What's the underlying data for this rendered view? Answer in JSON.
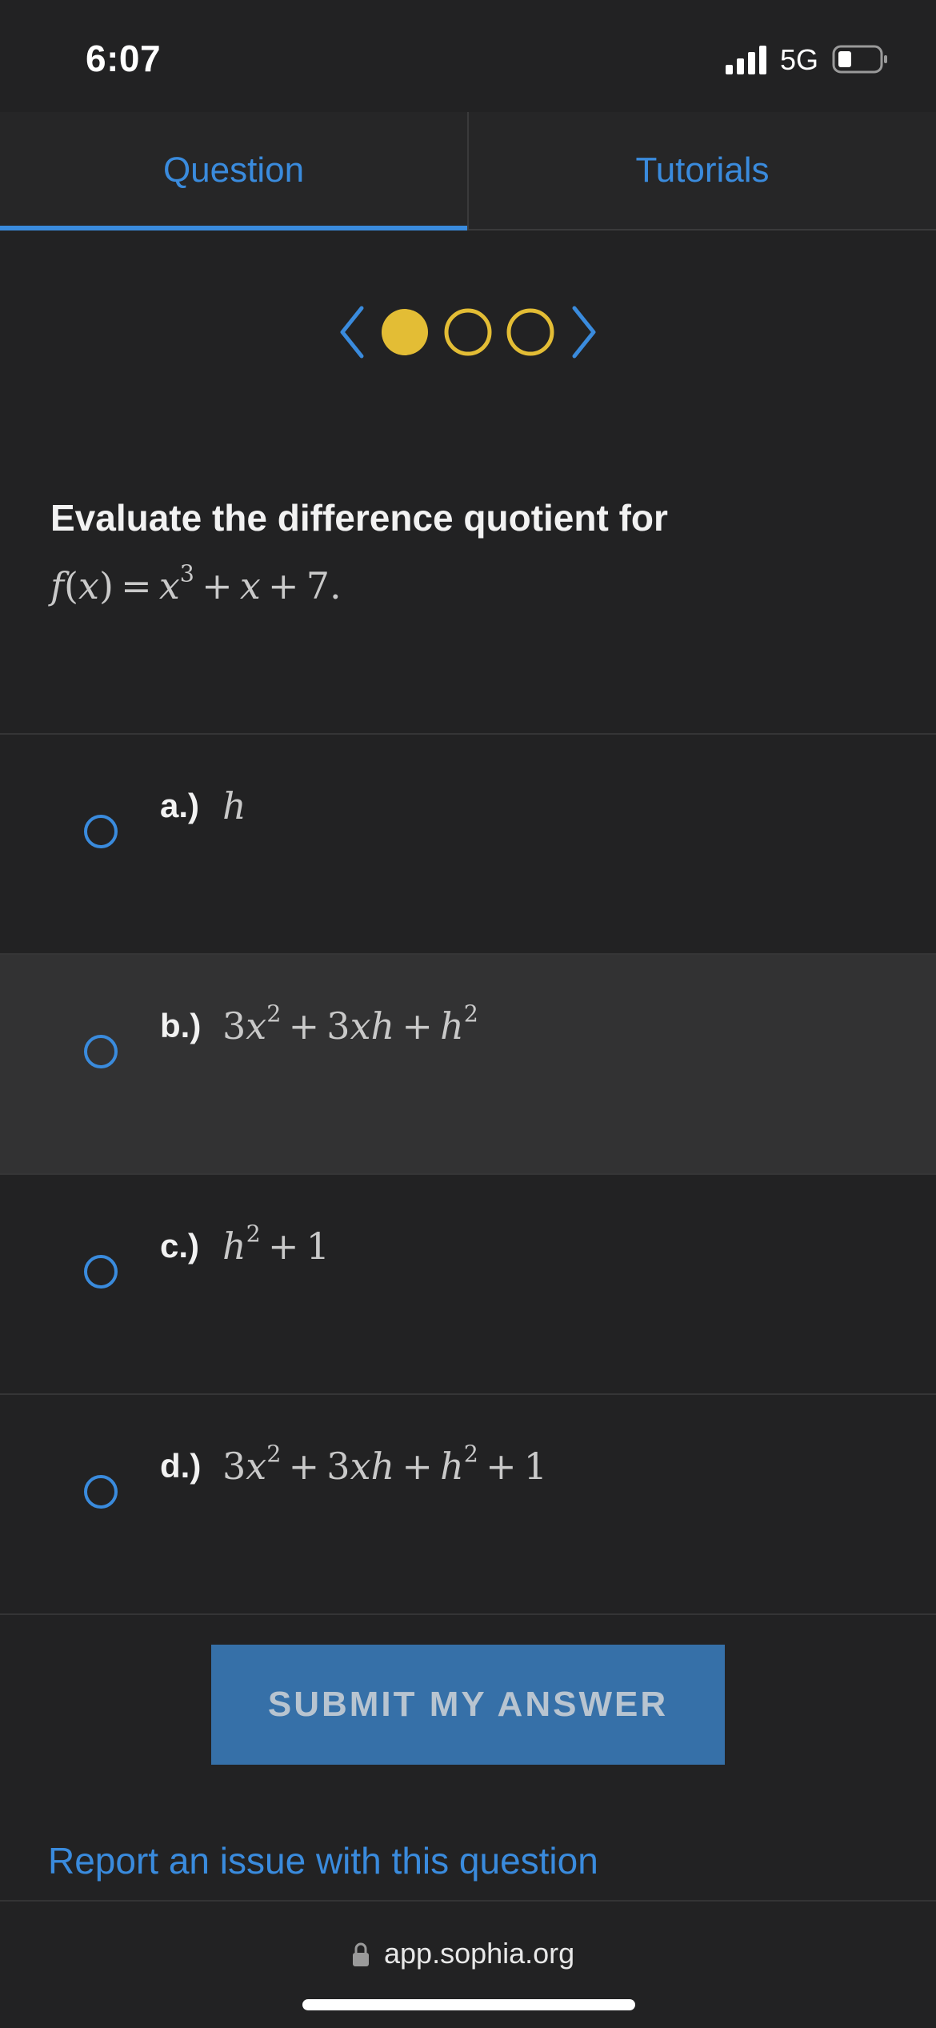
{
  "status": {
    "time": "6:07",
    "network": "5G"
  },
  "tabs": [
    {
      "label": "Question",
      "active": true
    },
    {
      "label": "Tutorials",
      "active": false
    }
  ],
  "pager": {
    "total": 3,
    "current": 1,
    "accent": "#e3bd35"
  },
  "question": {
    "prompt": "Evaluate the difference quotient for",
    "formula": "f(x)=x^3+x+7."
  },
  "answers": [
    {
      "letter": "a.)",
      "expr": "h"
    },
    {
      "letter": "b.)",
      "expr": "3x^2+3xh+h^2"
    },
    {
      "letter": "c.)",
      "expr": "h^2+1"
    },
    {
      "letter": "d.)",
      "expr": "3x^2+3xh+h^2+1"
    }
  ],
  "submit_label": "SUBMIT MY ANSWER",
  "report_link": "Report an issue with this question",
  "browser": {
    "url": "app.sophia.org"
  },
  "colors": {
    "accent_blue": "#3a8bdd",
    "button_blue": "#3670a8",
    "background": "#222223"
  }
}
